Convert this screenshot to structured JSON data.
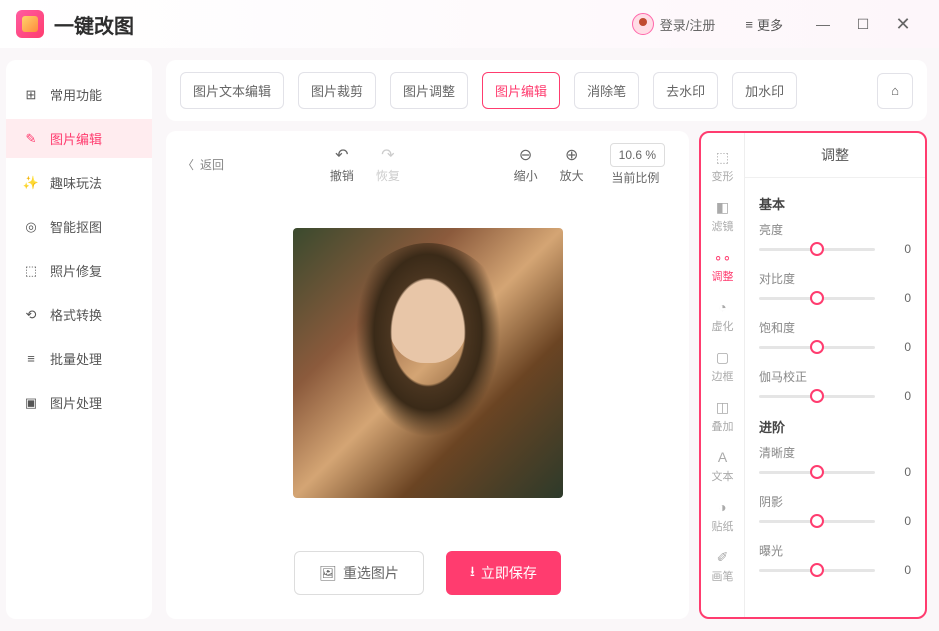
{
  "app": {
    "title": "一键改图"
  },
  "header": {
    "login": "登录/注册",
    "more": "更多"
  },
  "sidebar": {
    "items": [
      {
        "label": "常用功能"
      },
      {
        "label": "图片编辑"
      },
      {
        "label": "趣味玩法"
      },
      {
        "label": "智能抠图"
      },
      {
        "label": "照片修复"
      },
      {
        "label": "格式转换"
      },
      {
        "label": "批量处理"
      },
      {
        "label": "图片处理"
      }
    ]
  },
  "tabs": {
    "items": [
      {
        "label": "图片文本编辑"
      },
      {
        "label": "图片裁剪"
      },
      {
        "label": "图片调整"
      },
      {
        "label": "图片编辑"
      },
      {
        "label": "消除笔"
      },
      {
        "label": "去水印"
      },
      {
        "label": "加水印"
      }
    ]
  },
  "toolbar": {
    "back": "返回",
    "undo": "撤销",
    "redo": "恢复",
    "zoomout": "缩小",
    "zoomin": "放大",
    "ratio": "当前比例",
    "zoom": "10.6 %"
  },
  "actions": {
    "reselect": "重选图片",
    "save": "立即保存"
  },
  "toolstrip": {
    "items": [
      {
        "label": "变形"
      },
      {
        "label": "滤镜"
      },
      {
        "label": "调整"
      },
      {
        "label": "虚化"
      },
      {
        "label": "边框"
      },
      {
        "label": "叠加"
      },
      {
        "label": "文本"
      },
      {
        "label": "贴纸"
      },
      {
        "label": "画笔"
      }
    ]
  },
  "adjust": {
    "title": "调整",
    "basic": {
      "title": "基本",
      "sliders": [
        {
          "label": "亮度",
          "value": "0"
        },
        {
          "label": "对比度",
          "value": "0"
        },
        {
          "label": "饱和度",
          "value": "0"
        },
        {
          "label": "伽马校正",
          "value": "0"
        }
      ]
    },
    "advanced": {
      "title": "进阶",
      "sliders": [
        {
          "label": "清晰度",
          "value": "0"
        },
        {
          "label": "阴影",
          "value": "0"
        },
        {
          "label": "曝光",
          "value": "0"
        }
      ]
    }
  }
}
